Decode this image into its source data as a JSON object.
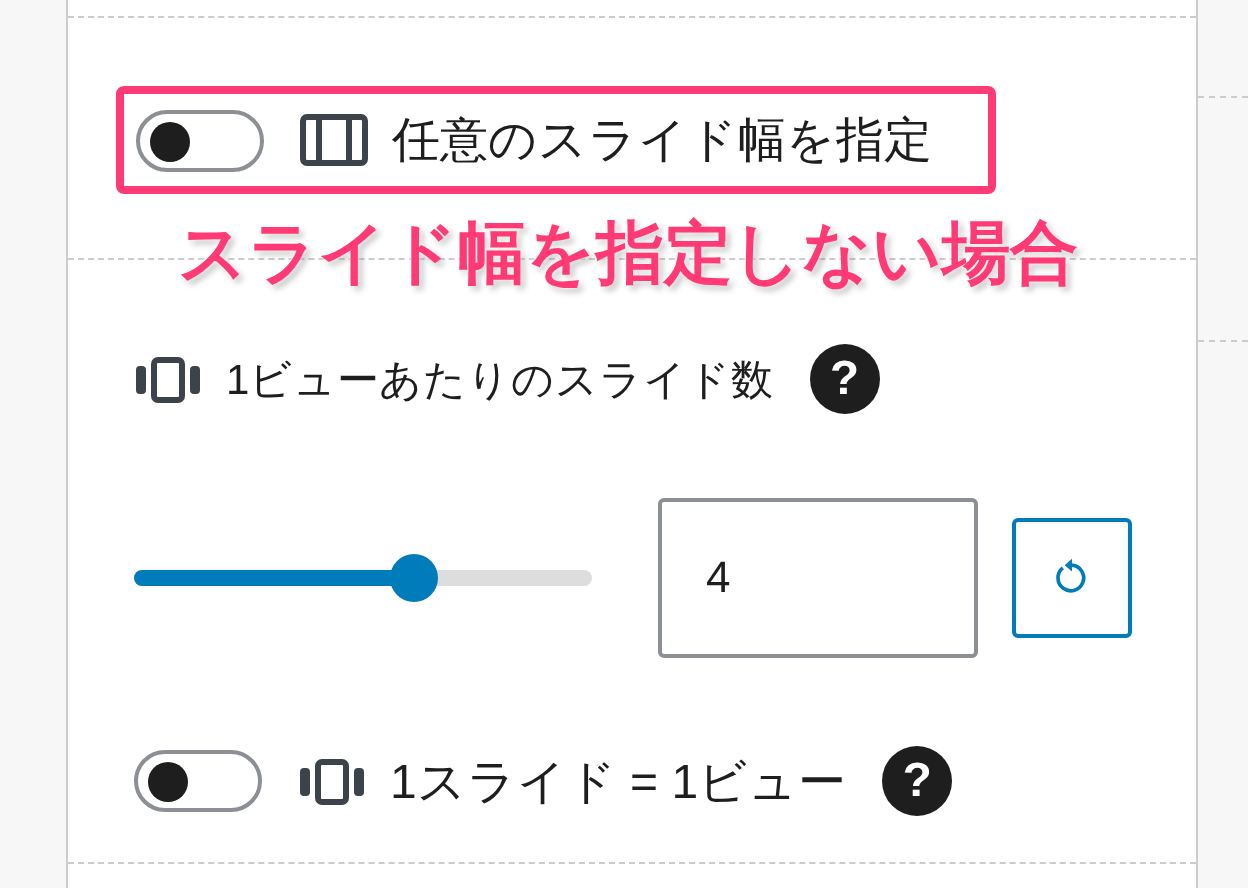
{
  "width_setting": {
    "label": "任意のスライド幅を指定",
    "on": false
  },
  "annotation": "スライド幅を指定しない場合",
  "slides_per_view": {
    "label": "1ビューあたりのスライド数",
    "help": "?",
    "level": 0.61,
    "value": "4"
  },
  "one_slide_one_view": {
    "label": "1スライド = 1ビュー",
    "help": "?",
    "on": false
  }
}
